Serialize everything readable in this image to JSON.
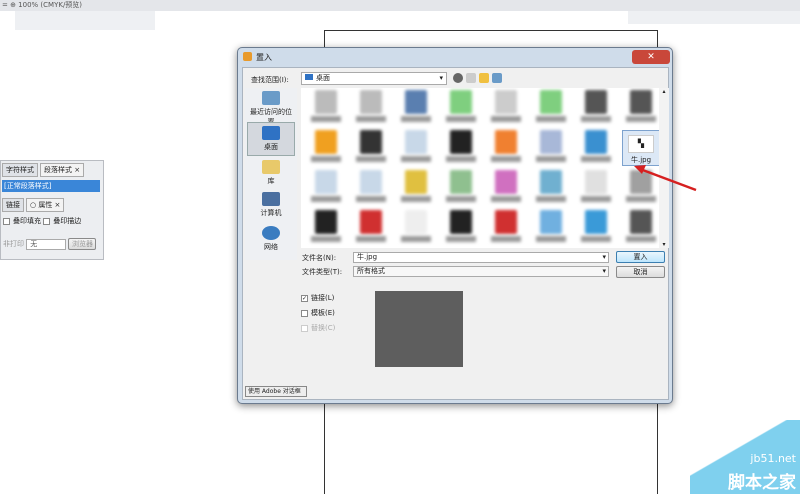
{
  "document": {
    "status": "= ⊕ 100% (CMYK/预览)"
  },
  "panel": {
    "tab1": "字符样式",
    "tab2": "段落样式 ×",
    "selected_style": "[正常段落样式]",
    "tab3": "链接",
    "tab4": "○ 属性 ×",
    "opt1": "叠印填充",
    "opt2": "叠印描边",
    "field_label": "非打印",
    "field_value": "无",
    "field_button": "浏览器"
  },
  "dialog": {
    "title": "置入",
    "close": "✕",
    "look_in_label": "查找范围(I):",
    "look_in_value": "桌面",
    "sidebar": [
      {
        "label": "最近访问的位置",
        "color": "#6a9bc8"
      },
      {
        "label": "桌面",
        "color": "#2f72c4"
      },
      {
        "label": "库",
        "color": "#e8c96a"
      },
      {
        "label": "计算机",
        "color": "#4a6fa0"
      },
      {
        "label": "网络",
        "color": "#3a7cc0"
      }
    ],
    "selected_file": "牛.jpg",
    "filename_label": "文件名(N):",
    "filename_value": "牛.jpg",
    "filetype_label": "文件类型(T):",
    "filetype_value": "所有格式",
    "open_button": "置入",
    "cancel_button": "取消",
    "checkboxes": [
      {
        "label": "链接(L)",
        "checked": true,
        "enabled": true
      },
      {
        "label": "模板(E)",
        "checked": false,
        "enabled": true
      },
      {
        "label": "替换(C)",
        "checked": false,
        "enabled": false
      }
    ],
    "adobe_button": "使用 Adobe 对话框"
  },
  "watermark": {
    "site": "jb51.net",
    "name": "脚本之家"
  },
  "colors": {
    "accent": "#2f72c4",
    "arrow": "#d62020"
  }
}
